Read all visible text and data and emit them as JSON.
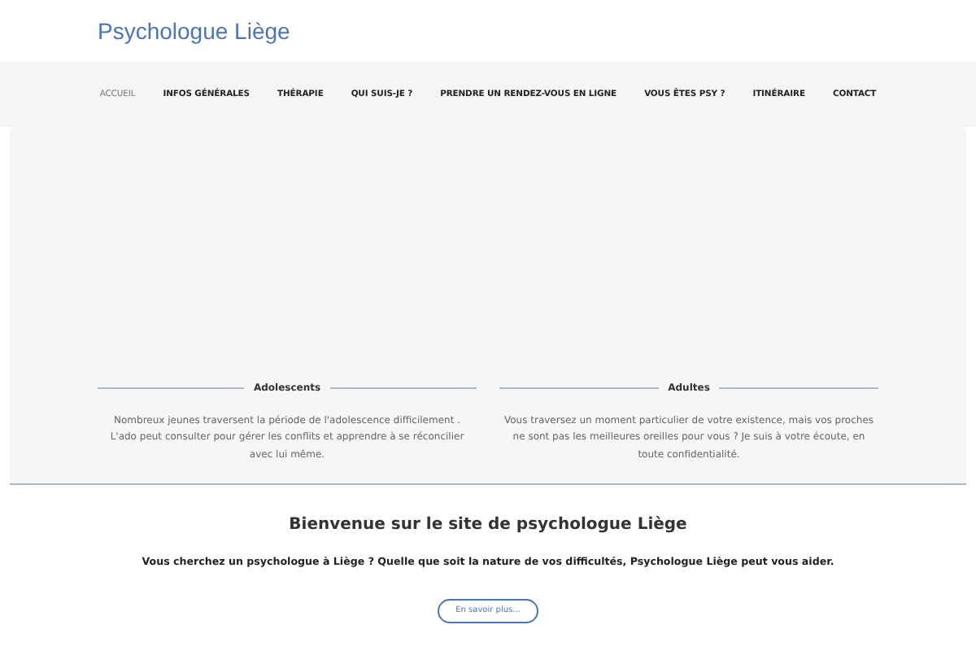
{
  "site_title": "Psychologue Liège",
  "nav": [
    {
      "label": "ACCUEIL",
      "selected": true
    },
    {
      "label": "INFOS GÉNÉRALES",
      "selected": false
    },
    {
      "label": "THÉRAPIE",
      "selected": false
    },
    {
      "label": "QUI SUIS-JE ?",
      "selected": false
    },
    {
      "label": "PRENDRE UN RENDEZ-VOUS EN LIGNE",
      "selected": false
    },
    {
      "label": "VOUS ÊTES PSY ?",
      "selected": false
    },
    {
      "label": "ITINÉRAIRE",
      "selected": false
    },
    {
      "label": "CONTACT",
      "selected": false
    }
  ],
  "columns": [
    {
      "title": "Adolescents",
      "text": "Nombreux jeunes traversent la période de l'adolescence difficilement . L'ado peut consulter pour gérer les conflits et apprendre à se réconcilier avec lui même."
    },
    {
      "title": "Adultes",
      "text": "Vous traversez un moment particulier de votre existence, mais vos proches ne sont pas les meilleures oreilles pour vous ? Je suis à votre écoute, en toute confidentialité."
    }
  ],
  "welcome": {
    "heading": "Bienvenue sur le site de psychologue Liège",
    "text": "Vous cherchez un psychologue à Liège ? Quelle que soit la nature de vos difficultés, Psychologue Liège peut vous aider.",
    "button": "En savoir plus..."
  }
}
